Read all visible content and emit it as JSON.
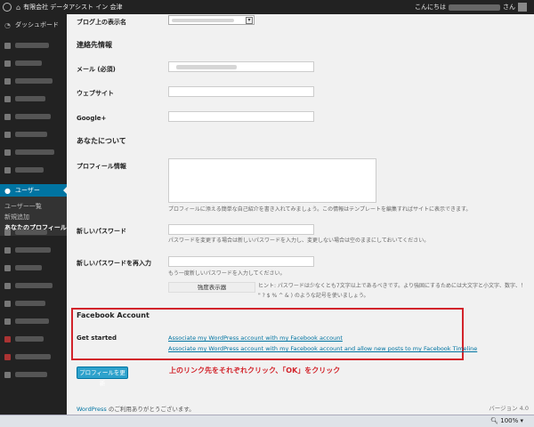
{
  "adminbar": {
    "site_name": "有限会社 データアシスト イン 会津",
    "howdy": "こんにちは",
    "howdy_suffix": "さん"
  },
  "sidebar": {
    "dashboard": "ダッシュボード",
    "users": "ユーザー",
    "submenu": [
      "ユーザー一覧",
      "新規追加",
      "あなたのプロフィール"
    ]
  },
  "profile": {
    "display_name_label": "ブログ上の表示名",
    "contact_title": "連絡先情報",
    "email_label": "メール (必須)",
    "website_label": "ウェブサイト",
    "googleplus_label": "Google+",
    "about_title": "あなたについて",
    "bio_label": "プロフィール情報",
    "bio_desc": "プロフィールに添える簡単な自己紹介を書き入れてみましょう。この情報はテンプレートを編集すればサイトに表示できます。",
    "new_password_label": "新しいパスワード",
    "new_password_desc": "パスワードを変更する場合は新しいパスワードを入力し、変更しない場合は空のままにしておいてください。",
    "repeat_password_label": "新しいパスワードを再入力",
    "repeat_password_desc": "もう一度新しいパスワードを入力してください。",
    "strength_label": "強度表示器",
    "hint_line1": "ヒント: パスワードは少なくとも7文字以上であるべきです。より強固にするためには大文字と小文字、数字、！",
    "hint_line2": "\" ? $ % ^ & ) のような記号を使いましょう。"
  },
  "facebook": {
    "title": "Facebook Account",
    "get_started_label": "Get started",
    "link1": "Associate my WordPress account with my Facebook account",
    "link2": "Associate my WordPress account with my Facebook account and allow new posts to my Facebook Timeline"
  },
  "actions": {
    "update_button": "プロフィールを更新",
    "annotation": "上のリンク先をそれぞれクリック、「OK」をクリック"
  },
  "footer": {
    "wordpress_link": "WordPress",
    "thanks": " のご利用ありがとうございます。",
    "version": "バージョン 4.0"
  },
  "statusbar": {
    "zoom": "100%"
  },
  "colors": {
    "admin_dark": "#222222",
    "accent_blue": "#0074a2",
    "highlight_red": "#d2232a"
  }
}
